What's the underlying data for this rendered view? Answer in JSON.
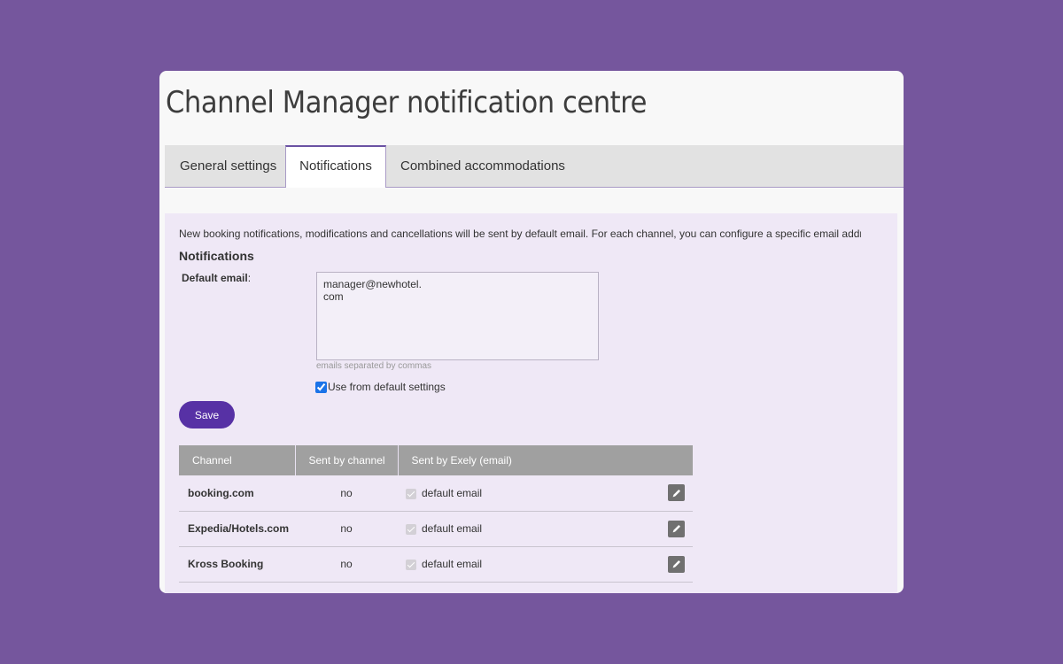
{
  "page": {
    "title": "Channel Manager notification centre"
  },
  "tabs": [
    {
      "label": "General settings",
      "active": false
    },
    {
      "label": "Notifications",
      "active": true
    },
    {
      "label": "Combined accommodations",
      "active": false
    }
  ],
  "notifications": {
    "info_text": "New booking notifications, modifications and cancellations will be sent by default email. For each channel, you can configure a specific email address",
    "section_title": "Notifications",
    "default_email_label": "Default email",
    "default_email_colon": ":",
    "default_email_value": "manager@newhotel.\ncom",
    "email_hint": "emails separated by commas",
    "use_default_label": "Use from default settings",
    "use_default_checked": true,
    "save_label": "Save"
  },
  "table": {
    "headers": [
      "Channel",
      "Sent by channel",
      "Sent by Exely (email)"
    ],
    "rows": [
      {
        "channel": "booking.com",
        "sent_by_channel": "no",
        "exely": "default email"
      },
      {
        "channel": "Expedia/Hotels.com",
        "sent_by_channel": "no",
        "exely": "default email"
      },
      {
        "channel": "Kross Booking",
        "sent_by_channel": "no",
        "exely": "default email"
      }
    ]
  },
  "colors": {
    "background": "#75569d",
    "accent": "#5731a5",
    "panel": "#efe8f6",
    "table_header": "#a0a0a0"
  },
  "icons": {
    "edit": "pencil-icon",
    "checkbox": "check-icon"
  }
}
